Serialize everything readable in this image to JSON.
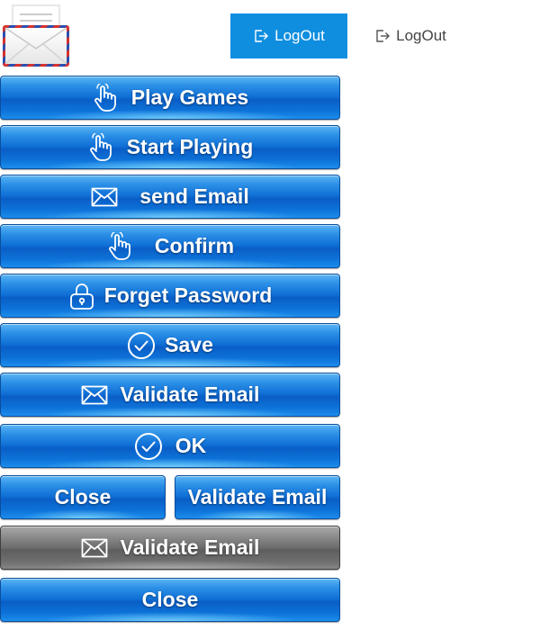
{
  "header": {
    "logout_primary_label": "LogOut",
    "logout_secondary_label": "LogOut"
  },
  "buttons": {
    "play_games": "Play Games",
    "start_playing": "Start Playing",
    "send_email": "send Email",
    "confirm": "Confirm",
    "forget_password": "Forget Password",
    "save": "Save",
    "validate_email_1": "Validate Email",
    "ok": "OK",
    "close_1": "Close",
    "validate_email_2": "Validate Email",
    "validate_email_gray": "Validate Email",
    "close_2": "Close"
  },
  "icons": {
    "logo": "mail-envelope-icon",
    "logout": "logout-icon",
    "hand": "hand-pointer-icon",
    "envelope": "envelope-icon",
    "lock": "lock-icon",
    "check": "check-circle-icon"
  },
  "colors": {
    "primary_blue": "#0f8ee0",
    "button_blue": "#0f6fd6",
    "button_gray": "#6c6c6c",
    "text_white": "#ffffff"
  }
}
